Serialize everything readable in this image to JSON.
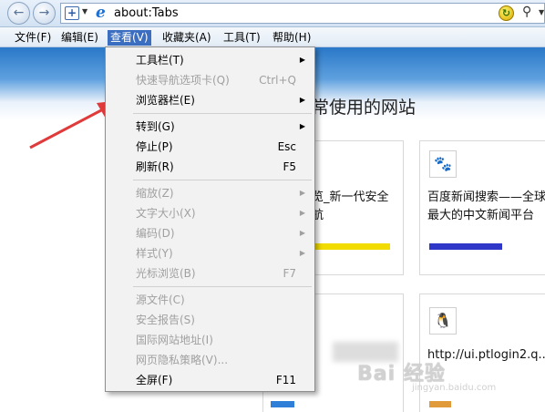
{
  "address_bar": {
    "url": "about:Tabs",
    "back_icon": "back-arrow-icon",
    "forward_icon": "forward-arrow-icon",
    "search_icon": "magnifier-icon"
  },
  "menubar": {
    "items": [
      {
        "label": "文件(F)"
      },
      {
        "label": "编辑(E)"
      },
      {
        "label": "查看(V)"
      },
      {
        "label": "收藏夹(A)"
      },
      {
        "label": "工具(T)"
      },
      {
        "label": "帮助(H)"
      }
    ],
    "active_color": "#3b6ec0"
  },
  "view_menu": {
    "items": [
      {
        "label": "工具栏(T)",
        "shortcut": "",
        "submenu": true,
        "enabled": true
      },
      {
        "label": "快速导航选项卡(Q)",
        "shortcut": "Ctrl+Q",
        "submenu": false,
        "enabled": false
      },
      {
        "label": "浏览器栏(E)",
        "shortcut": "",
        "submenu": true,
        "enabled": true
      },
      {
        "label": "转到(G)",
        "shortcut": "",
        "submenu": true,
        "enabled": true
      },
      {
        "label": "停止(P)",
        "shortcut": "Esc",
        "submenu": false,
        "enabled": true
      },
      {
        "label": "刷新(R)",
        "shortcut": "F5",
        "submenu": false,
        "enabled": true
      },
      {
        "label": "缩放(Z)",
        "shortcut": "",
        "submenu": true,
        "enabled": false
      },
      {
        "label": "文字大小(X)",
        "shortcut": "",
        "submenu": true,
        "enabled": false
      },
      {
        "label": "编码(D)",
        "shortcut": "",
        "submenu": true,
        "enabled": false
      },
      {
        "label": "样式(Y)",
        "shortcut": "",
        "submenu": true,
        "enabled": false
      },
      {
        "label": "光标浏览(B)",
        "shortcut": "F7",
        "submenu": false,
        "enabled": false
      },
      {
        "label": "源文件(C)",
        "shortcut": "",
        "submenu": false,
        "enabled": false
      },
      {
        "label": "安全报告(S)",
        "shortcut": "",
        "submenu": false,
        "enabled": false
      },
      {
        "label": "国际网站地址(I)",
        "shortcut": "",
        "submenu": false,
        "enabled": false
      },
      {
        "label": "网页隐私策略(V)...",
        "shortcut": "",
        "submenu": false,
        "enabled": false
      },
      {
        "label": "全屏(F)",
        "shortcut": "F11",
        "submenu": false,
        "enabled": true
      }
    ]
  },
  "page": {
    "heading": "常使用的网站",
    "tiles": [
      {
        "text_line1": "览_新一代安全",
        "text_line2": "航",
        "bar_color": "#f2dc00"
      },
      {
        "text_line1": "百度新闻搜索——全球",
        "text_line2": "最大的中文新闻平台",
        "bar_color": "#2f37c9",
        "icon": "baidu-paw-icon"
      },
      {
        "text_line1": "http://ui.ptlogin2.q...",
        "text_line2": "",
        "bar_color": "#e09a3a",
        "icon": "qq-penguin-icon"
      },
      {
        "bar_color": "#2f7fd8"
      }
    ]
  },
  "annotation": {
    "color": "#e03a3a"
  },
  "watermark": {
    "text": "Bai 经验",
    "url": "jingyan.baidu.com"
  }
}
